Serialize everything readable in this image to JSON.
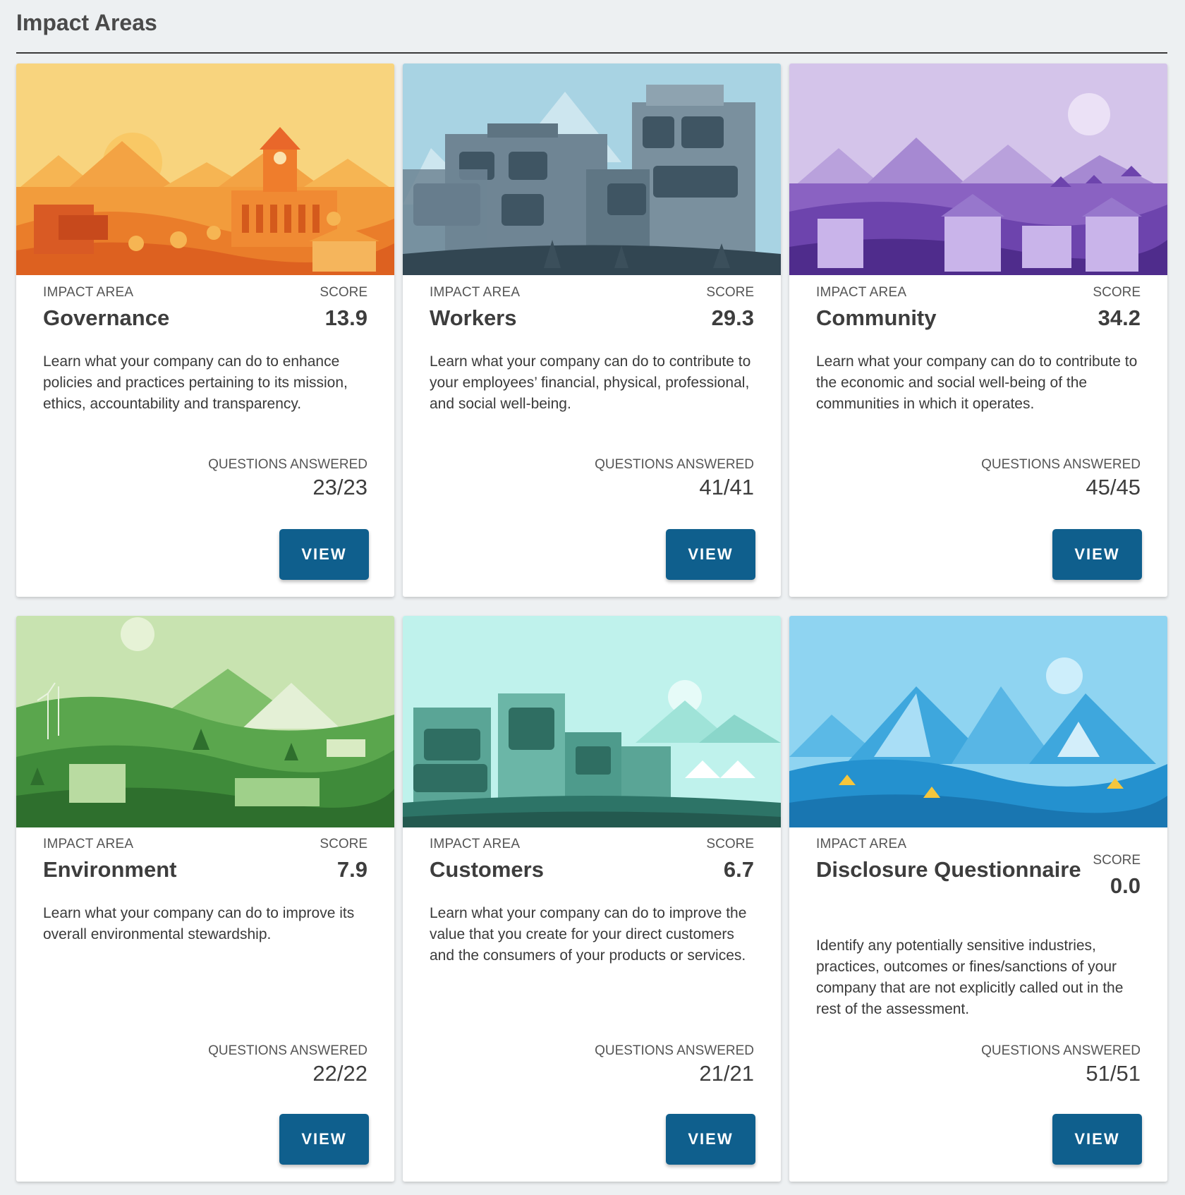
{
  "page": {
    "title": "Impact Areas"
  },
  "labels": {
    "impact_area": "IMPACT AREA",
    "score": "SCORE",
    "questions_answered": "QUESTIONS ANSWERED",
    "view": "VIEW"
  },
  "cards": [
    {
      "name": "Governance",
      "score": "13.9",
      "description": "Learn what your company can do to enhance policies and practices pertaining to its mission, ethics, accountability and transparency.",
      "questions": "23/23",
      "theme": "orange"
    },
    {
      "name": "Workers",
      "score": "29.3",
      "description": "Learn what your company can do to contribute to your employees’ financial, physical, professional, and social well-being.",
      "questions": "41/41",
      "theme": "slate"
    },
    {
      "name": "Community",
      "score": "34.2",
      "description": "Learn what your company can do to contribute to the economic and social well-being of the communities in which it operates.",
      "questions": "45/45",
      "theme": "purple"
    },
    {
      "name": "Environment",
      "score": "7.9",
      "description": "Learn what your company can do to improve its overall environmental stewardship.",
      "questions": "22/22",
      "theme": "green"
    },
    {
      "name": "Customers",
      "score": "6.7",
      "description": "Learn what your company can do to improve the value that you create for your direct customers and the consumers of your products or services.",
      "questions": "21/21",
      "theme": "teal"
    },
    {
      "name": "Disclosure Questionnaire",
      "score": "0.0",
      "description": "Identify any potentially sensitive industries, practices, outcomes or fines/sanctions of your company that are not explicitly called out in the rest of the assessment.",
      "questions": "51/51",
      "theme": "blue"
    }
  ],
  "colors": {
    "view_button": "#0f5f8d",
    "background": "#edf0f2"
  }
}
